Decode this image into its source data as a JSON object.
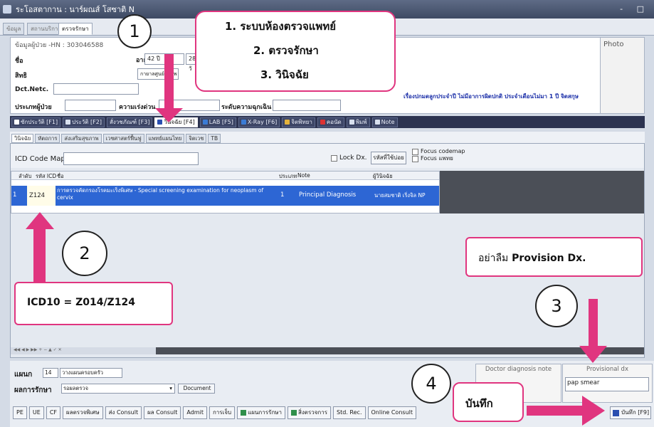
{
  "titlebar": {
    "text": "ระโอสตากาน : นาร์ผณส์ โสซาติ N",
    "controls": "- □"
  },
  "toptabs": [
    "ข้อมูล",
    "สถานบริการ",
    "ตรวจรักษา"
  ],
  "patient": {
    "hn_line": "ข้อมูลผู้ป่วย -HN : 303046588",
    "name_label": "ชื่อ",
    "right_label": "สิทธิ",
    "dct_label": "Dct.Netc.",
    "type_label": "ประเภทผู้ป่วย",
    "urgency_label": "ความเร่งด่วน",
    "emergency_label": "ระดับความฉุกเฉิน",
    "age_label": "อายุ",
    "age_value": "42 ปี",
    "extra_value": "28 วั",
    "hospital_value": "กายาลศูนย์ โรงพ",
    "photo_label": "Photo",
    "alert": "เรื่องปกมดลูกประจำปี ไม่มีอาการผิดปกติ ประจำเดือนไม่มา 1 ปี จิตสกุษ"
  },
  "maintabs": [
    {
      "label": "ซักประวัติ [F1]",
      "color": "#ffffff"
    },
    {
      "label": "ประวัติ [F2]",
      "color": "#d8e0ee"
    },
    {
      "label": "สั่งวชภัณฑ์ [F3]",
      "color": "#d8e0ee"
    },
    {
      "label": "วินิจฉัย [F4]",
      "color": "#2a4fb0"
    },
    {
      "label": "LAB [F5]",
      "color": "#3a7bd5"
    },
    {
      "label": "X-Ray [F6]",
      "color": "#3a7bd5"
    },
    {
      "label": "จิตพิทยา",
      "color": "#e3b23c"
    },
    {
      "label": "คอนัด",
      "color": "#d33"
    },
    {
      "label": "พิมพ์",
      "color": "#d8e0ee"
    },
    {
      "label": "Note",
      "color": "#d8e0ee"
    }
  ],
  "subtabs": [
    "วินิจฉัย",
    "หัตถการ",
    "ส่งเสริมสุขภาพ",
    "เวชศาสตร์ฟื้นฟู",
    "แพทย์แผนไทย",
    "จิตเวช",
    "TB"
  ],
  "icd": {
    "label": "ICD Code Map",
    "lock_label": "Lock Dx.",
    "clear_btn": "รหัสที่ใช้บ่อย",
    "focus_codemap": "Focus codemap",
    "focus_name": "Focus แพทย"
  },
  "grid": {
    "headers": [
      "ลำดับ",
      "รหัส ICD",
      "ชื่อ",
      "ประเภท",
      "Note",
      "ผู้วินิจฉัย"
    ],
    "row": {
      "seq": "1",
      "code": "Z124",
      "name": "การตรวจคัดกรองโรคมะเร็งพิเศษ - Special screening examination for neoplasm of cervix",
      "type": "1",
      "note": "Principal Diagnosis",
      "doctor": "นายสมชาติ เริ่งจิล NP"
    }
  },
  "bottom": {
    "dept_label": "แผนก",
    "dept_code": "14",
    "dept_name": "วางแผนครอบครัว",
    "result_label": "ผลการรักษา",
    "result_value": "รอผลตรวจ",
    "document_btn": "Document",
    "doc_note_label": "Doctor diagnosis note",
    "prov_dx_label": "Provisional dx",
    "prov_dx_value": "pap smear",
    "buttons": [
      "PE",
      "UE",
      "CF",
      "ผลตรวจพิเศษ",
      "ส่ง Consult",
      "ผล Consult",
      "Admit",
      "การเจ็บ",
      "แผนการรักษา",
      "สิ่งตรวจการ",
      "Std. Rec.",
      "Online Consult"
    ],
    "save_btn": "บันทึก [F9]"
  },
  "annotations": {
    "callout1_line1_num": "1.",
    "callout1_line1": "ระบบห้องตรวจแพทย์",
    "callout1_line2_num": "2.",
    "callout1_line2": "ตรวจรักษา",
    "callout1_line3_num": "3.",
    "callout1_line3": "วินิจฉัย",
    "step1": "1",
    "step2": "2",
    "step3": "3",
    "step4": "4",
    "icd10_note": "ICD10 = Z014/Z124",
    "provision_prefix": "อย่าลืม",
    "provision_text": "Provision Dx.",
    "save_label": "บันทึก",
    "accent": "#e0357f"
  }
}
